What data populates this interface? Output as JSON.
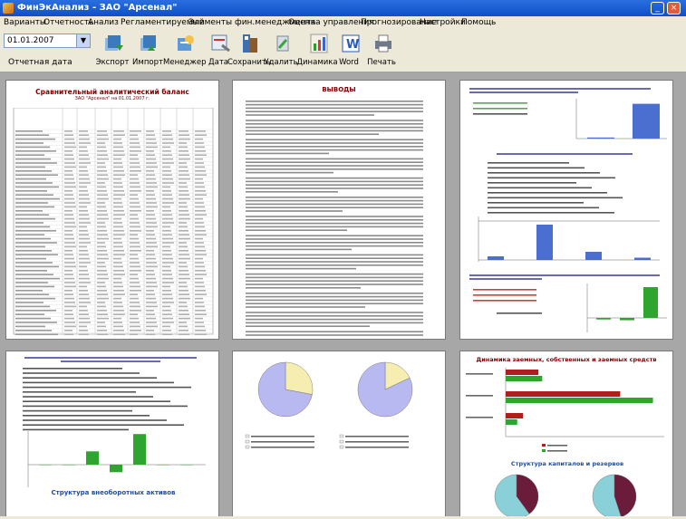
{
  "window": {
    "title": "ФинЭкАнализ - ЗАО \"Арсенал\""
  },
  "menu": [
    "Варианты",
    "Отчетность",
    "Анализ",
    "Регламентируемый",
    "Элементы фин.менеджмента",
    "Оценка управления",
    "Прогнозирование",
    "Настройки",
    "Помощь"
  ],
  "toolbar": {
    "date_value": "01.01.2007",
    "date_label": "Отчетная дата",
    "buttons": [
      {
        "label": "Экспорт",
        "icon": "export-icon"
      },
      {
        "label": "Импорт",
        "icon": "import-icon"
      },
      {
        "label": "Менеджер",
        "icon": "manager-icon"
      },
      {
        "label": "Дата",
        "icon": "date-icon"
      },
      {
        "label": "Сохранить",
        "icon": "save-icon"
      },
      {
        "label": "Удалить",
        "icon": "delete-icon"
      },
      {
        "label": "Динамика",
        "icon": "dynamics-icon"
      },
      {
        "label": "Word",
        "icon": "word-icon"
      },
      {
        "label": "Печать",
        "icon": "print-icon"
      }
    ]
  },
  "pages": {
    "p1": {
      "title": "Сравнительный аналитический баланс",
      "subtitle": "ЗАО \"Арсенал\" на 01.01.2007 г."
    },
    "p2": {
      "title": "ВЫВОДЫ"
    },
    "p5": {
      "title": "Структура внеоборотных активов"
    },
    "p6": {
      "title": "Динамика заемных, собственных и заемных средств",
      "subtitle": "Структура капиталов и резервов"
    }
  },
  "chart_data": [
    {
      "type": "bar",
      "values": [
        3,
        96
      ],
      "note": "page 3 top chart"
    },
    {
      "type": "bar",
      "values": [
        0.8,
        0,
        7.8,
        0,
        1.8,
        0,
        0.5
      ],
      "note": "page 3 middle chart"
    },
    {
      "type": "bar",
      "values": [
        -2,
        -3,
        40
      ],
      "note": "page 3 bottom chart"
    },
    {
      "type": "bar",
      "values": [
        0,
        0,
        34.6,
        -19.6,
        79.5,
        0,
        0
      ],
      "note": "page 4 chart"
    },
    {
      "type": "bar",
      "series": [
        {
          "name": "",
          "values": [
            34,
            119,
            18
          ]
        },
        {
          "name": "",
          "values": [
            38,
            153,
            12
          ]
        }
      ],
      "categories": [
        "",
        "",
        ""
      ],
      "note": "page 6 chart"
    }
  ]
}
